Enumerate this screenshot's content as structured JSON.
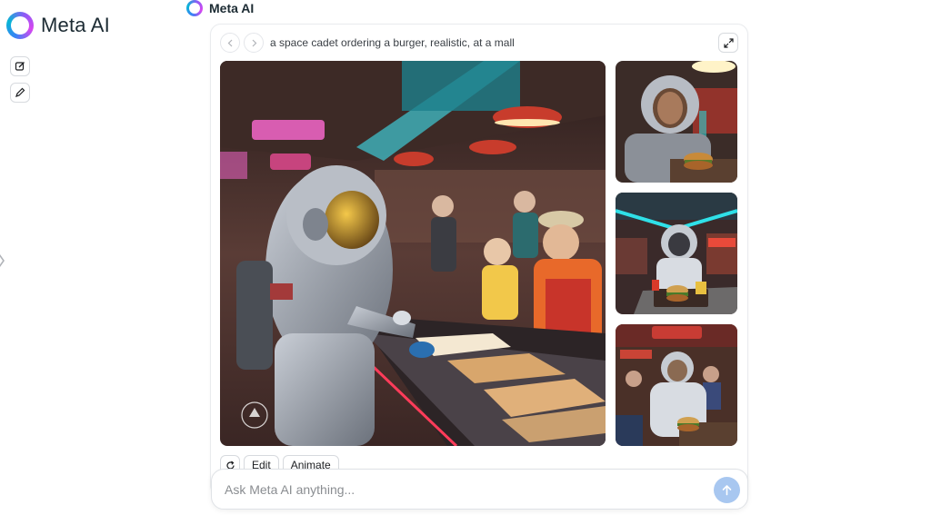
{
  "app": {
    "brand_name": "Meta AI"
  },
  "sidebar": {
    "new_chat_icon": "new-chat-icon",
    "edit_icon": "pencil-icon",
    "collapse_icon": "chevron-right-icon"
  },
  "message": {
    "sender": "Meta AI",
    "prompt": "a space cadet ordering a burger, realistic, at a mall",
    "images": [
      {
        "role": "main",
        "description": "astronaut at fast food counter"
      },
      {
        "role": "thumbnail",
        "description": "astronaut seated with burger"
      },
      {
        "role": "thumbnail",
        "description": "astronaut with burger tray"
      },
      {
        "role": "thumbnail",
        "description": "astronaut in food court"
      }
    ],
    "actions": {
      "regenerate_icon": "refresh-icon",
      "edit_label": "Edit",
      "animate_label": "Animate"
    }
  },
  "composer": {
    "placeholder": "Ask Meta AI anything...",
    "send_icon": "arrow-up-icon"
  },
  "colors": {
    "accent": "#a8c7f0",
    "brand_gradient": [
      "#3b82f6",
      "#06b6d4",
      "#8b5cf6",
      "#d946ef"
    ]
  }
}
